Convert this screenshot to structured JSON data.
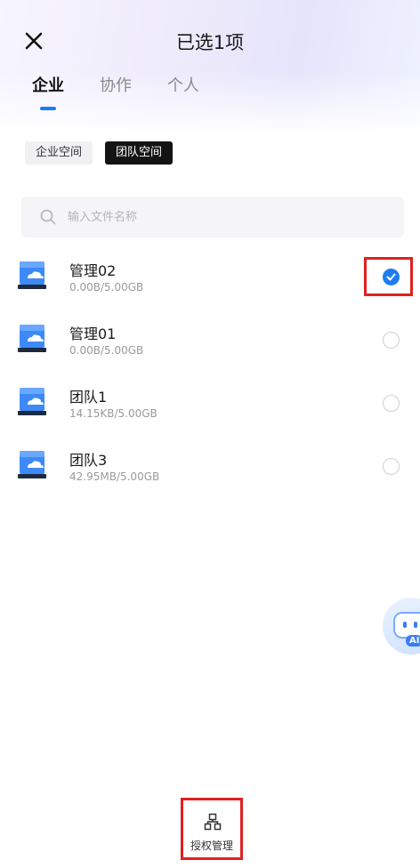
{
  "header": {
    "title": "已选1项",
    "close_icon": "close-icon"
  },
  "tabs": [
    {
      "label": "企业",
      "active": true
    },
    {
      "label": "协作",
      "active": false
    },
    {
      "label": "个人",
      "active": false
    }
  ],
  "spaces": [
    {
      "label": "企业空间",
      "active": false
    },
    {
      "label": "团队空间",
      "active": true
    }
  ],
  "search": {
    "placeholder": "输入文件名称",
    "value": "",
    "icon": "search-icon"
  },
  "items": [
    {
      "name": "管理02",
      "size": "0.00B/5.00GB",
      "checked": true
    },
    {
      "name": "管理01",
      "size": "0.00B/5.00GB",
      "checked": false
    },
    {
      "name": "团队1",
      "size": "14.15KB/5.00GB",
      "checked": false
    },
    {
      "name": "团队3",
      "size": "42.95MB/5.00GB",
      "checked": false
    }
  ],
  "ai_assistant": {
    "label": "AI"
  },
  "bottom_action": {
    "label": "授权管理",
    "icon": "org-chart-icon"
  },
  "colors": {
    "accent": "#1f7cf0",
    "highlight_box": "#e02020"
  }
}
